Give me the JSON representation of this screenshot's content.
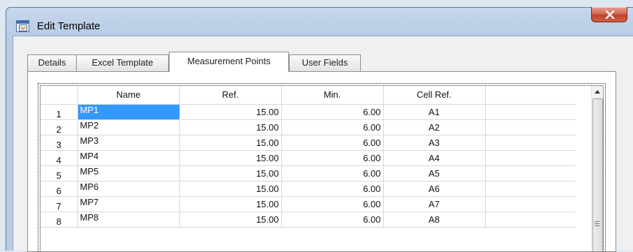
{
  "window": {
    "title": "Edit Template",
    "close_icon": "close-icon",
    "app_icon": "form-window-icon"
  },
  "tabs": [
    {
      "label": "Details",
      "active": false
    },
    {
      "label": "Excel Template",
      "active": false
    },
    {
      "label": "Measurement Points",
      "active": true
    },
    {
      "label": "User Fields",
      "active": false
    }
  ],
  "grid": {
    "columns": [
      "Name",
      "Ref.",
      "Min.",
      "Cell Ref."
    ],
    "rows": [
      {
        "num": "1",
        "name": "MP1",
        "ref": "15.00",
        "min": "6.00",
        "cell": "A1"
      },
      {
        "num": "2",
        "name": "MP2",
        "ref": "15.00",
        "min": "6.00",
        "cell": "A2"
      },
      {
        "num": "3",
        "name": "MP3",
        "ref": "15.00",
        "min": "6.00",
        "cell": "A3"
      },
      {
        "num": "4",
        "name": "MP4",
        "ref": "15.00",
        "min": "6.00",
        "cell": "A4"
      },
      {
        "num": "5",
        "name": "MP5",
        "ref": "15.00",
        "min": "6.00",
        "cell": "A5"
      },
      {
        "num": "6",
        "name": "MP6",
        "ref": "15.00",
        "min": "6.00",
        "cell": "A6"
      },
      {
        "num": "7",
        "name": "MP7",
        "ref": "15.00",
        "min": "6.00",
        "cell": "A7"
      },
      {
        "num": "8",
        "name": "MP8",
        "ref": "15.00",
        "min": "6.00",
        "cell": "A8"
      }
    ],
    "selected_row_index": 0
  },
  "colors": {
    "selection": "#3399ff",
    "close_button": "#c7432b"
  }
}
